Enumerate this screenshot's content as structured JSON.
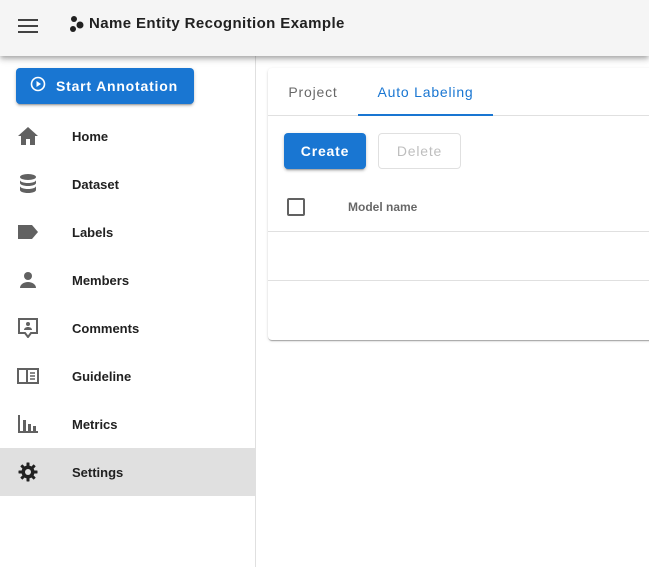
{
  "header": {
    "title": "Name Entity Recognition Example",
    "menu_icon": "hamburger-menu-icon",
    "logo_icon": "doccano-logo-icon"
  },
  "sidebar": {
    "start_button": "Start Annotation",
    "items": [
      {
        "label": "Home",
        "icon": "home-icon"
      },
      {
        "label": "Dataset",
        "icon": "database-icon"
      },
      {
        "label": "Labels",
        "icon": "label-icon"
      },
      {
        "label": "Members",
        "icon": "account-icon"
      },
      {
        "label": "Comments",
        "icon": "comment-account-icon"
      },
      {
        "label": "Guideline",
        "icon": "book-open-icon"
      },
      {
        "label": "Metrics",
        "icon": "chart-bar-icon"
      },
      {
        "label": "Settings",
        "icon": "cog-icon",
        "active": true
      }
    ]
  },
  "main": {
    "tabs": [
      {
        "label": "Project"
      },
      {
        "label": "Auto Labeling",
        "active": true
      }
    ],
    "create_label": "Create",
    "delete_label": "Delete",
    "table": {
      "columns": [
        "Model name"
      ]
    }
  },
  "colors": {
    "primary": "#1976d2",
    "appbar": "#f5f5f5",
    "active_nav": "#e0e0e0"
  }
}
